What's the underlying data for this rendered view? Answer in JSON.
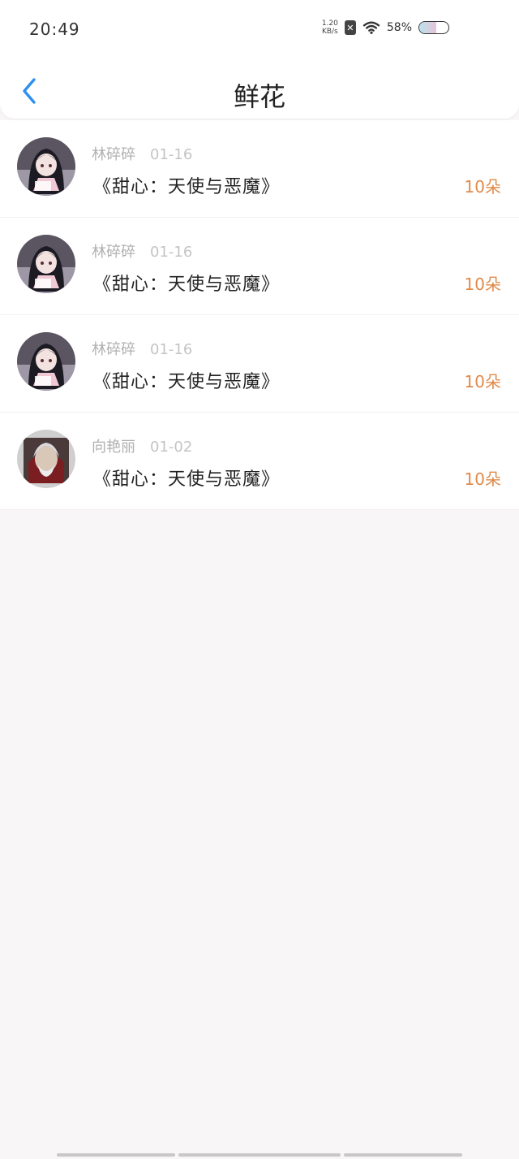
{
  "status_bar": {
    "time": "20:49",
    "net_speed_value": "1.20",
    "net_speed_unit": "KB/s",
    "battery_percent": "58%",
    "battery_level": 0.58
  },
  "header": {
    "title": "鲜花"
  },
  "rows": [
    {
      "user": "林碎碎",
      "date": "01-16",
      "book": "《甜心：天使与恶魔》",
      "count": "10朵"
    },
    {
      "user": "林碎碎",
      "date": "01-16",
      "book": "《甜心：天使与恶魔》",
      "count": "10朵"
    },
    {
      "user": "林碎碎",
      "date": "01-16",
      "book": "《甜心：天使与恶魔》",
      "count": "10朵"
    },
    {
      "user": "向艳丽",
      "date": "01-02",
      "book": "《甜心：天使与恶魔》",
      "count": "10朵"
    }
  ],
  "colors": {
    "accent_blue": "#2e8ff0",
    "count_orange": "#e08a4a"
  }
}
